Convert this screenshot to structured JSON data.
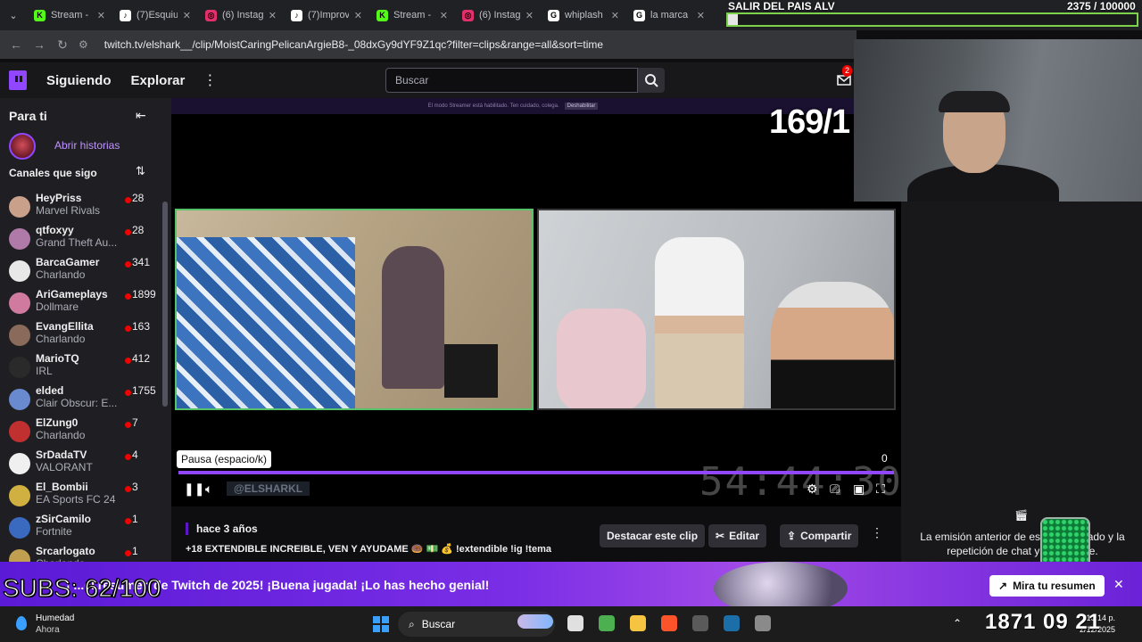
{
  "browser": {
    "tabs": [
      {
        "title": "Stream -",
        "color": "#53fc18",
        "glyph": "K"
      },
      {
        "title": "(7)Esquiu",
        "color": "#ffffff",
        "glyph": "♪"
      },
      {
        "title": "(6) Instag",
        "color": "#e1306c",
        "glyph": "◎"
      },
      {
        "title": "(7)Improv",
        "color": "#ffffff",
        "glyph": "♪"
      },
      {
        "title": "Stream -",
        "color": "#53fc18",
        "glyph": "K"
      },
      {
        "title": "(6) Instag",
        "color": "#e1306c",
        "glyph": "◎"
      },
      {
        "title": "whiplash",
        "color": "#ffffff",
        "glyph": "G"
      },
      {
        "title": "la marca",
        "color": "#ffffff",
        "glyph": "G"
      }
    ],
    "url": "twitch.tv/elshark__/clip/MoistCaringPelicanArgieB8-_08dxGy9dYF9Z1qc?filter=clips&range=all&sort=time"
  },
  "topnav": {
    "following": "Siguiendo",
    "browse": "Explorar",
    "search_placeholder": "Buscar",
    "inbox_badge": "2"
  },
  "sidebar": {
    "for_you": "Para ti",
    "open_stories": "Abrir historias",
    "followed_channels": "Canales que sigo",
    "channels": [
      {
        "name": "HeyPriss",
        "game": "Marvel Rivals",
        "viewers": "28",
        "color": "#c9a08a"
      },
      {
        "name": "qtfoxyy",
        "game": "Grand Theft Au...",
        "viewers": "28",
        "color": "#b07aa8"
      },
      {
        "name": "BarcaGamer",
        "game": "Charlando",
        "viewers": "341",
        "color": "#e8e8e8"
      },
      {
        "name": "AriGameplays",
        "game": "Dollmare",
        "viewers": "1899",
        "color": "#d07aa0"
      },
      {
        "name": "EvangEllita",
        "game": "Charlando",
        "viewers": "163",
        "color": "#8a6a5a"
      },
      {
        "name": "MarioTQ",
        "game": "IRL",
        "viewers": "412",
        "color": "#2a2a2a"
      },
      {
        "name": "elded",
        "game": "Clair Obscur: E...",
        "viewers": "1755",
        "color": "#6a8ad0"
      },
      {
        "name": "ElZung0",
        "game": "Charlando",
        "viewers": "7",
        "color": "#c03030"
      },
      {
        "name": "SrDadaTV",
        "game": "VALORANT",
        "viewers": "4",
        "color": "#f0f0f0"
      },
      {
        "name": "El_Bombii",
        "game": "EA Sports FC 24",
        "viewers": "3",
        "color": "#d0b040"
      },
      {
        "name": "zSirCamilo",
        "game": "Fortnite",
        "viewers": "1",
        "color": "#3a6ac0"
      },
      {
        "name": "Srcarlogato",
        "game": "Charlando",
        "viewers": "1",
        "color": "#c0a050"
      }
    ]
  },
  "player": {
    "streamer_mode_text": "El modo Streamer está habilitado. Ten cuidado, colega.",
    "streamer_disable": "Deshabilitar",
    "counter_overlay": "169/1",
    "timer_overlay": "54:44:30",
    "tooltip": "Pausa (espacio/k)",
    "progress_end": "0",
    "progress_fraction": 1.0,
    "watermark": "@ELSHARKL"
  },
  "clip": {
    "age": "hace 3 años",
    "title": "+18 EXTENDIBLE INCREIBLE, VEN Y AYUDAME 🍩 💵 💰 !extendible !ig !tema",
    "feature_button": "Destacar este clip",
    "edit_button": "Editar",
    "share_button": "Compartir"
  },
  "stream_overlay": {
    "title": "SALIR DEL PAIS ALV",
    "goal": "2375 / 100000",
    "goal_fraction": 0.024,
    "subs": "SUBS: 62/100",
    "clock": "1871  09  21"
  },
  "right_panel": {
    "chat_note": "La emisión anterior de este ... educado y la repetición de chat ya n... onible."
  },
  "recap": {
    "text": "¡ ...el resumen de Twitch de 2025! ¡Buena jugada! ¡Lo has hecho genial!",
    "button": "Mira tu resumen"
  },
  "taskbar": {
    "weather": "Humedad",
    "weather_sub": "Ahora",
    "search": "Buscar",
    "time": "10:14 p.",
    "date": "2/12/2025",
    "apps": [
      {
        "name": "task-view",
        "color": "#e0e0e0"
      },
      {
        "name": "chrome",
        "color": "#4caf50"
      },
      {
        "name": "file-explorer",
        "color": "#f5c542"
      },
      {
        "name": "brave",
        "color": "#fb542b"
      },
      {
        "name": "obs",
        "color": "#5a5a5a"
      },
      {
        "name": "steam",
        "color": "#1b6ea8"
      },
      {
        "name": "settings",
        "color": "#8a8a8a"
      }
    ]
  },
  "colors": {
    "accent": "#9147ff",
    "live": "#eb0400",
    "background": "#0e0e10"
  }
}
